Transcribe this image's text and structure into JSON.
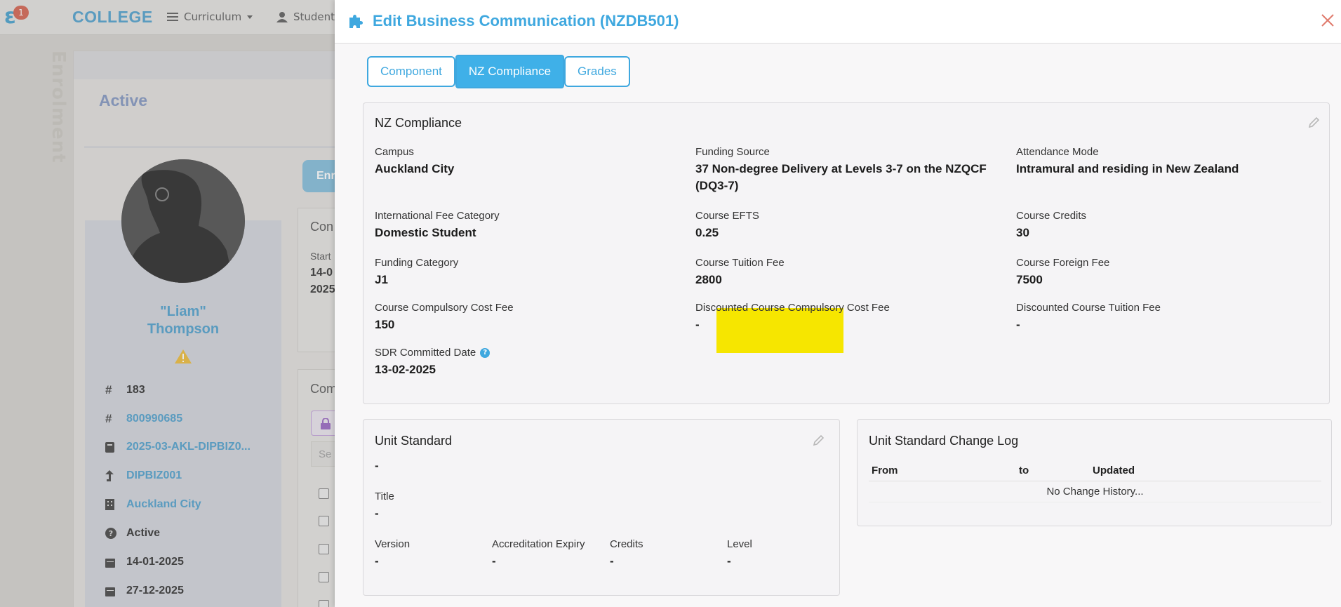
{
  "app": {
    "brand": "COLLEGE",
    "logo_letter": "ɛ",
    "notification_count": "1",
    "nav": {
      "curriculum": "Curriculum",
      "students": "Students"
    },
    "vertical_title": "Enrolment"
  },
  "background": {
    "status_heading": "Active",
    "student_name_line1": "\"Liam\"",
    "student_name_line2": "Thompson",
    "enrol_button": "Enr",
    "info": [
      {
        "icon": "#",
        "value": "183",
        "link": false
      },
      {
        "icon": "#",
        "value": "800990685",
        "link": true
      },
      {
        "icon": "book-icon",
        "value": "2025-03-AKL-DIPBIZ0...",
        "link": true
      },
      {
        "icon": "level-up-icon",
        "value": "DIPBIZ001",
        "link": true
      },
      {
        "icon": "building-icon",
        "value": "Auckland City",
        "link": true
      },
      {
        "icon": "question-circle-icon",
        "value": "Active",
        "link": false
      },
      {
        "icon": "calendar-icon",
        "value": "14-01-2025",
        "link": false
      },
      {
        "icon": "calendar-icon",
        "value": "27-12-2025",
        "link": false
      }
    ],
    "course_box": {
      "title": "Con",
      "start_label": "Start",
      "start_1": "14-0",
      "start_2": "2025"
    },
    "components_box": {
      "title": "Com",
      "search_prefix": "Se"
    }
  },
  "modal": {
    "title": "Edit Business Communication (NZDB501)",
    "tabs": [
      {
        "label": "Component",
        "active": false
      },
      {
        "label": "NZ Compliance",
        "active": true
      },
      {
        "label": "Grades",
        "active": false
      }
    ],
    "nz_compliance": {
      "title": "NZ Compliance",
      "fields": {
        "campus": {
          "label": "Campus",
          "value": "Auckland City"
        },
        "funding_source": {
          "label": "Funding Source",
          "value": "37 Non-degree Delivery at Levels 3-7 on the NZQCF (DQ3-7)"
        },
        "attendance_mode": {
          "label": "Attendance Mode",
          "value": "Intramural and residing in New Zealand"
        },
        "intl_fee_category": {
          "label": "International Fee Category",
          "value": "Domestic Student"
        },
        "course_efts": {
          "label": "Course EFTS",
          "value": "0.25"
        },
        "course_credits": {
          "label": "Course Credits",
          "value": "30"
        },
        "funding_category": {
          "label": "Funding Category",
          "value": "J1"
        },
        "course_tuition_fee": {
          "label": "Course Tuition Fee",
          "value": "2800"
        },
        "course_foreign_fee": {
          "label": "Course Foreign Fee",
          "value": "7500"
        },
        "course_compulsory_cost_fee": {
          "label": "Course Compulsory Cost Fee",
          "value": "150"
        },
        "discounted_compulsory_cost_fee": {
          "label": "Discounted Course Compulsory Cost Fee",
          "value": "-"
        },
        "discounted_tuition_fee": {
          "label": "Discounted Course Tuition Fee",
          "value": "-"
        },
        "sdr_committed_date": {
          "label": "SDR Committed Date",
          "value": "13-02-2025"
        }
      },
      "highlight_color": "#f6e600"
    },
    "unit_standard": {
      "title": "Unit Standard",
      "code": "-",
      "title_label": "Title",
      "title_value": "-",
      "version_label": "Version",
      "version_value": "-",
      "accreditation_label": "Accreditation Expiry",
      "accreditation_value": "-",
      "credits_label": "Credits",
      "credits_value": "-",
      "level_label": "Level",
      "level_value": "-"
    },
    "change_log": {
      "title": "Unit Standard Change Log",
      "columns": {
        "from": "From",
        "to": "to",
        "updated": "Updated"
      },
      "empty_message": "No Change History..."
    }
  },
  "colors": {
    "accent": "#3fa8df",
    "brand": "#5fa9d2",
    "close": "#e07a6c"
  }
}
